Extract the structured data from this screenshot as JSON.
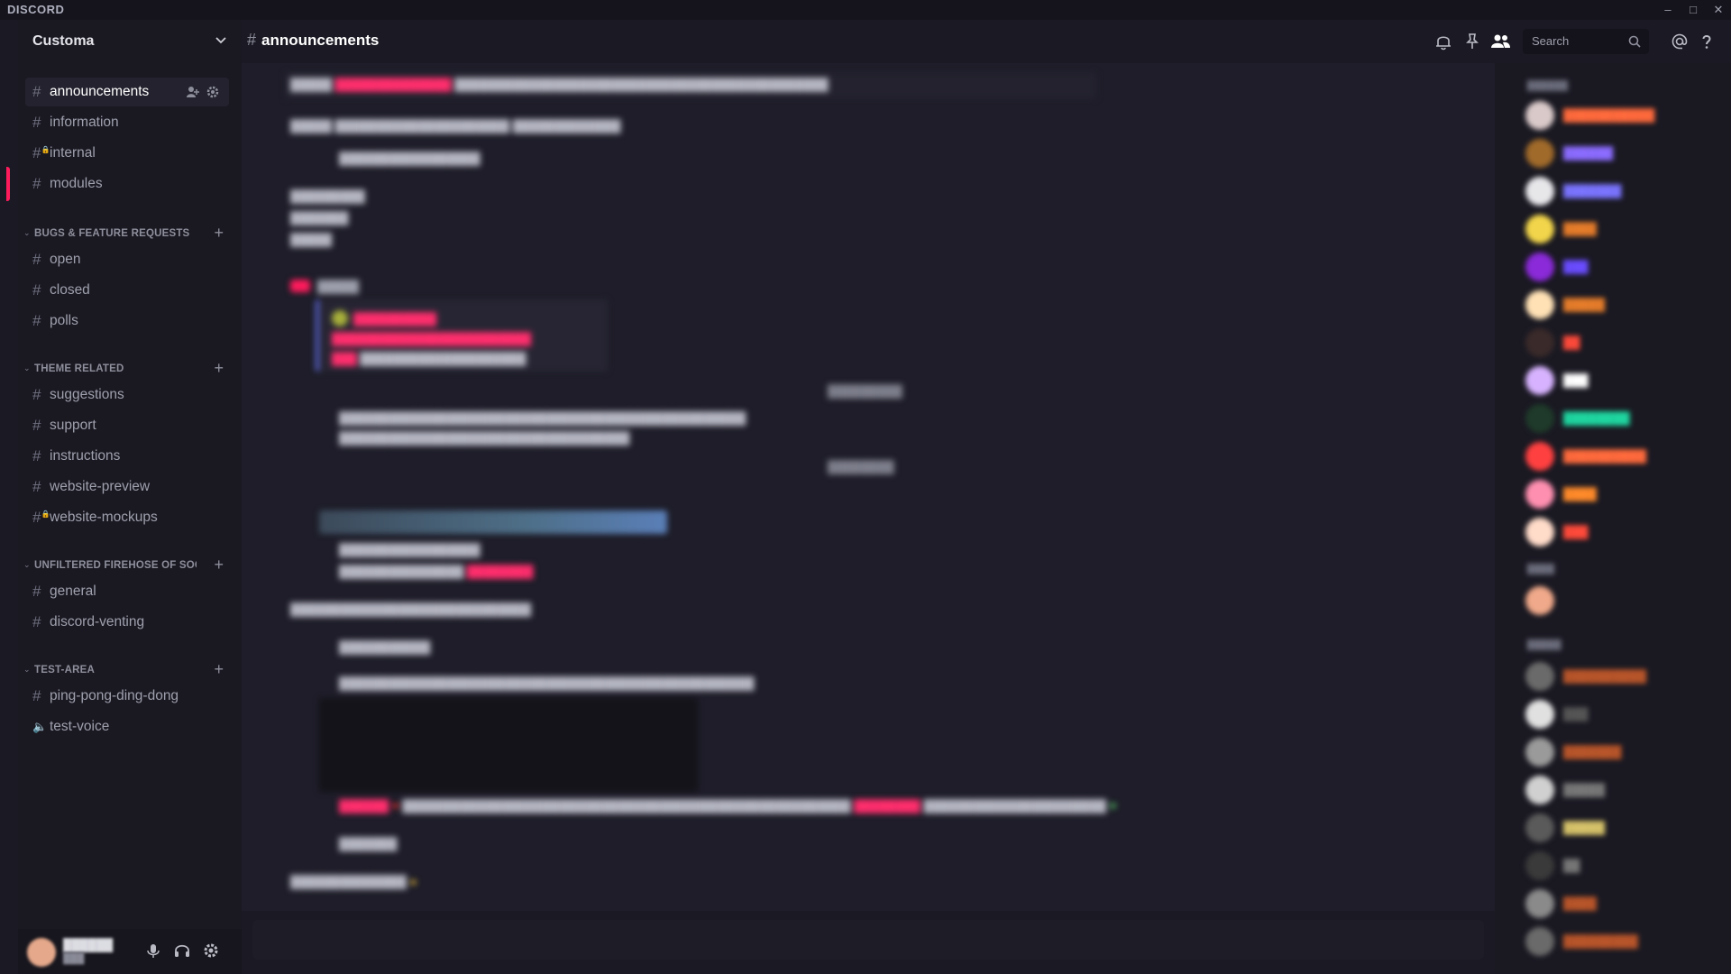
{
  "app": {
    "brand": "DISCORD"
  },
  "window_controls": [
    "minimize",
    "maximize",
    "close"
  ],
  "server": {
    "name": "Customa"
  },
  "channels_top": [
    {
      "name": "announcements",
      "icon": "hash",
      "active": true
    },
    {
      "name": "information",
      "icon": "hash"
    },
    {
      "name": "internal",
      "icon": "locked-hash"
    },
    {
      "name": "modules",
      "icon": "hash"
    }
  ],
  "categories": [
    {
      "label": "BUGS & FEATURE REQUESTS",
      "channels": [
        "open",
        "closed",
        "polls"
      ]
    },
    {
      "label": "THEME RELATED",
      "channels": [
        "suggestions",
        "support",
        "instructions",
        "website-preview",
        "website-mockups"
      ]
    },
    {
      "label": "UNFILTERED FIREHOSE OF SOC...",
      "channels": [
        "general",
        "discord-venting"
      ]
    },
    {
      "label": "TEST-AREA",
      "channels": [
        "ping-pong-ding-dong",
        "test-voice"
      ]
    }
  ],
  "header": {
    "channel": "announcements",
    "search_placeholder": "Search"
  },
  "icons": {
    "notifications": "bell-icon",
    "pins": "pin-icon",
    "members": "members-icon",
    "mentions": "at-icon",
    "help": "help-icon"
  },
  "colors": {
    "accent": "#ff1b5c",
    "blurple": "#5b67d8"
  }
}
